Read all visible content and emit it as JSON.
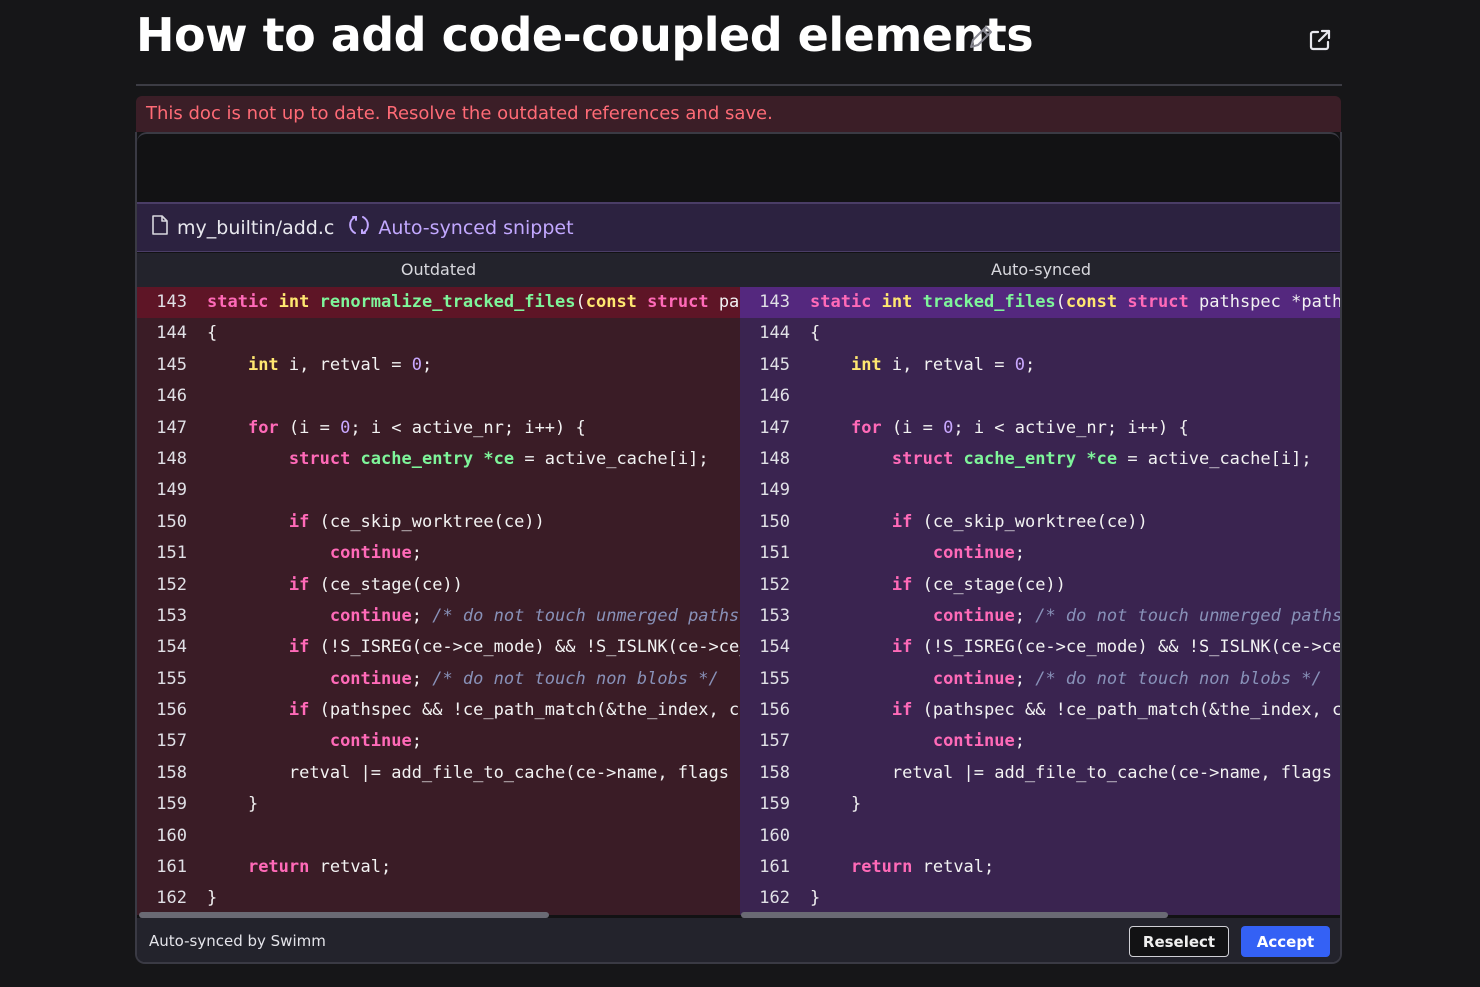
{
  "header": {
    "title": "How to add code-coupled elements",
    "edit_icon": "pencil-icon",
    "open_icon": "external-link-icon"
  },
  "banner": {
    "message": "This doc is not up to date. Resolve the outdated references and save."
  },
  "snippet": {
    "file_name": "my_builtin/add.c",
    "file_icon": "file-icon",
    "sync_icon": "sync-icon",
    "sync_label": "Auto-synced snippet"
  },
  "columns": {
    "left": "Outdated",
    "right": "Auto-synced"
  },
  "left_lines": [
    [
      {
        "t": "static ",
        "c": "kw"
      },
      {
        "t": "int ",
        "c": "ty"
      },
      {
        "t": "renormalize_tracked_files",
        "c": "fn"
      },
      {
        "t": "(",
        "c": ""
      },
      {
        "t": "const ",
        "c": "ty"
      },
      {
        "t": "struct ",
        "c": "kw"
      },
      {
        "t": "pathspec *pathspec",
        "c": ""
      }
    ],
    [
      {
        "t": "{",
        "c": ""
      }
    ],
    [
      {
        "t": "    ",
        "c": ""
      },
      {
        "t": "int ",
        "c": "ty"
      },
      {
        "t": "i, retval = ",
        "c": ""
      },
      {
        "t": "0",
        "c": "num"
      },
      {
        "t": ";",
        "c": ""
      }
    ],
    [],
    [
      {
        "t": "    ",
        "c": ""
      },
      {
        "t": "for ",
        "c": "kw"
      },
      {
        "t": "(i = ",
        "c": ""
      },
      {
        "t": "0",
        "c": "num"
      },
      {
        "t": "; i < active_nr; i++) {",
        "c": ""
      }
    ],
    [
      {
        "t": "        ",
        "c": ""
      },
      {
        "t": "struct ",
        "c": "kw"
      },
      {
        "t": "cache_entry ",
        "c": "fn"
      },
      {
        "t": "*ce",
        "c": "fn"
      },
      {
        "t": " = active_cache[i];",
        "c": ""
      }
    ],
    [],
    [
      {
        "t": "        ",
        "c": ""
      },
      {
        "t": "if ",
        "c": "kw"
      },
      {
        "t": "(ce_skip_worktree(ce))",
        "c": ""
      }
    ],
    [
      {
        "t": "            ",
        "c": ""
      },
      {
        "t": "continue",
        "c": "kw"
      },
      {
        "t": ";",
        "c": ""
      }
    ],
    [
      {
        "t": "        ",
        "c": ""
      },
      {
        "t": "if ",
        "c": "kw"
      },
      {
        "t": "(ce_stage(ce))",
        "c": ""
      }
    ],
    [
      {
        "t": "            ",
        "c": ""
      },
      {
        "t": "continue",
        "c": "kw"
      },
      {
        "t": "; ",
        "c": ""
      },
      {
        "t": "/* do not touch unmerged paths */",
        "c": "cm"
      }
    ],
    [
      {
        "t": "        ",
        "c": ""
      },
      {
        "t": "if ",
        "c": "kw"
      },
      {
        "t": "(!S_ISREG(ce->ce_mode) && !S_ISLNK(ce->ce_mode))",
        "c": ""
      }
    ],
    [
      {
        "t": "            ",
        "c": ""
      },
      {
        "t": "continue",
        "c": "kw"
      },
      {
        "t": "; ",
        "c": ""
      },
      {
        "t": "/* do not touch non blobs */",
        "c": "cm"
      }
    ],
    [
      {
        "t": "        ",
        "c": ""
      },
      {
        "t": "if ",
        "c": "kw"
      },
      {
        "t": "(pathspec && !ce_path_match(&the_index, ce, pathspec, NULL))",
        "c": ""
      }
    ],
    [
      {
        "t": "            ",
        "c": ""
      },
      {
        "t": "continue",
        "c": "kw"
      },
      {
        "t": ";",
        "c": ""
      }
    ],
    [
      {
        "t": "        retval |= add_file_to_cache(ce->name, flags | ADD_CACHE_RENORMALIZE);",
        "c": ""
      }
    ],
    [
      {
        "t": "    }",
        "c": ""
      }
    ],
    [],
    [
      {
        "t": "    ",
        "c": ""
      },
      {
        "t": "return ",
        "c": "kw"
      },
      {
        "t": "retval;",
        "c": ""
      }
    ],
    [
      {
        "t": "}",
        "c": ""
      }
    ]
  ],
  "right_lines": [
    [
      {
        "t": "static ",
        "c": "kw"
      },
      {
        "t": "int ",
        "c": "ty"
      },
      {
        "t": "tracked_files",
        "c": "fn"
      },
      {
        "t": "(",
        "c": ""
      },
      {
        "t": "const ",
        "c": "ty"
      },
      {
        "t": "struct ",
        "c": "kw"
      },
      {
        "t": "pathspec *pathspec, int flags)",
        "c": ""
      }
    ],
    [
      {
        "t": "{",
        "c": ""
      }
    ],
    [
      {
        "t": "    ",
        "c": ""
      },
      {
        "t": "int ",
        "c": "ty"
      },
      {
        "t": "i, retval = ",
        "c": ""
      },
      {
        "t": "0",
        "c": "num"
      },
      {
        "t": ";",
        "c": ""
      }
    ],
    [],
    [
      {
        "t": "    ",
        "c": ""
      },
      {
        "t": "for ",
        "c": "kw"
      },
      {
        "t": "(i = ",
        "c": ""
      },
      {
        "t": "0",
        "c": "num"
      },
      {
        "t": "; i < active_nr; i++) {",
        "c": ""
      }
    ],
    [
      {
        "t": "        ",
        "c": ""
      },
      {
        "t": "struct ",
        "c": "kw"
      },
      {
        "t": "cache_entry ",
        "c": "fn"
      },
      {
        "t": "*ce",
        "c": "fn"
      },
      {
        "t": " = active_cache[i];",
        "c": ""
      }
    ],
    [],
    [
      {
        "t": "        ",
        "c": ""
      },
      {
        "t": "if ",
        "c": "kw"
      },
      {
        "t": "(ce_skip_worktree(ce))",
        "c": ""
      }
    ],
    [
      {
        "t": "            ",
        "c": ""
      },
      {
        "t": "continue",
        "c": "kw"
      },
      {
        "t": ";",
        "c": ""
      }
    ],
    [
      {
        "t": "        ",
        "c": ""
      },
      {
        "t": "if ",
        "c": "kw"
      },
      {
        "t": "(ce_stage(ce))",
        "c": ""
      }
    ],
    [
      {
        "t": "            ",
        "c": ""
      },
      {
        "t": "continue",
        "c": "kw"
      },
      {
        "t": "; ",
        "c": ""
      },
      {
        "t": "/* do not touch unmerged paths */",
        "c": "cm"
      }
    ],
    [
      {
        "t": "        ",
        "c": ""
      },
      {
        "t": "if ",
        "c": "kw"
      },
      {
        "t": "(!S_ISREG(ce->ce_mode) && !S_ISLNK(ce->ce_mode))",
        "c": ""
      }
    ],
    [
      {
        "t": "            ",
        "c": ""
      },
      {
        "t": "continue",
        "c": "kw"
      },
      {
        "t": "; ",
        "c": ""
      },
      {
        "t": "/* do not touch non blobs */",
        "c": "cm"
      }
    ],
    [
      {
        "t": "        ",
        "c": ""
      },
      {
        "t": "if ",
        "c": "kw"
      },
      {
        "t": "(pathspec && !ce_path_match(&the_index, ce, pathspec, NULL))",
        "c": ""
      }
    ],
    [
      {
        "t": "            ",
        "c": ""
      },
      {
        "t": "continue",
        "c": "kw"
      },
      {
        "t": ";",
        "c": ""
      }
    ],
    [
      {
        "t": "        retval |= add_file_to_cache(ce->name, flags | ADD_CACHE_RENORMALIZE);",
        "c": ""
      }
    ],
    [
      {
        "t": "    }",
        "c": ""
      }
    ],
    [],
    [
      {
        "t": "    ",
        "c": ""
      },
      {
        "t": "return ",
        "c": "kw"
      },
      {
        "t": "retval;",
        "c": ""
      }
    ],
    [
      {
        "t": "}",
        "c": ""
      }
    ]
  ],
  "line_numbers": [
    "143",
    "144",
    "145",
    "146",
    "147",
    "148",
    "149",
    "150",
    "151",
    "152",
    "153",
    "154",
    "155",
    "156",
    "157",
    "158",
    "159",
    "160",
    "161",
    "162"
  ],
  "footer": {
    "label": "Auto-synced by Swimm",
    "reselect_label": "Reselect",
    "accept_label": "Accept"
  },
  "colors": {
    "accent": "#3461f5",
    "outdated_bg": "#3a1c26",
    "synced_bg": "#3a2450",
    "warning_text": "#ff6b76"
  }
}
